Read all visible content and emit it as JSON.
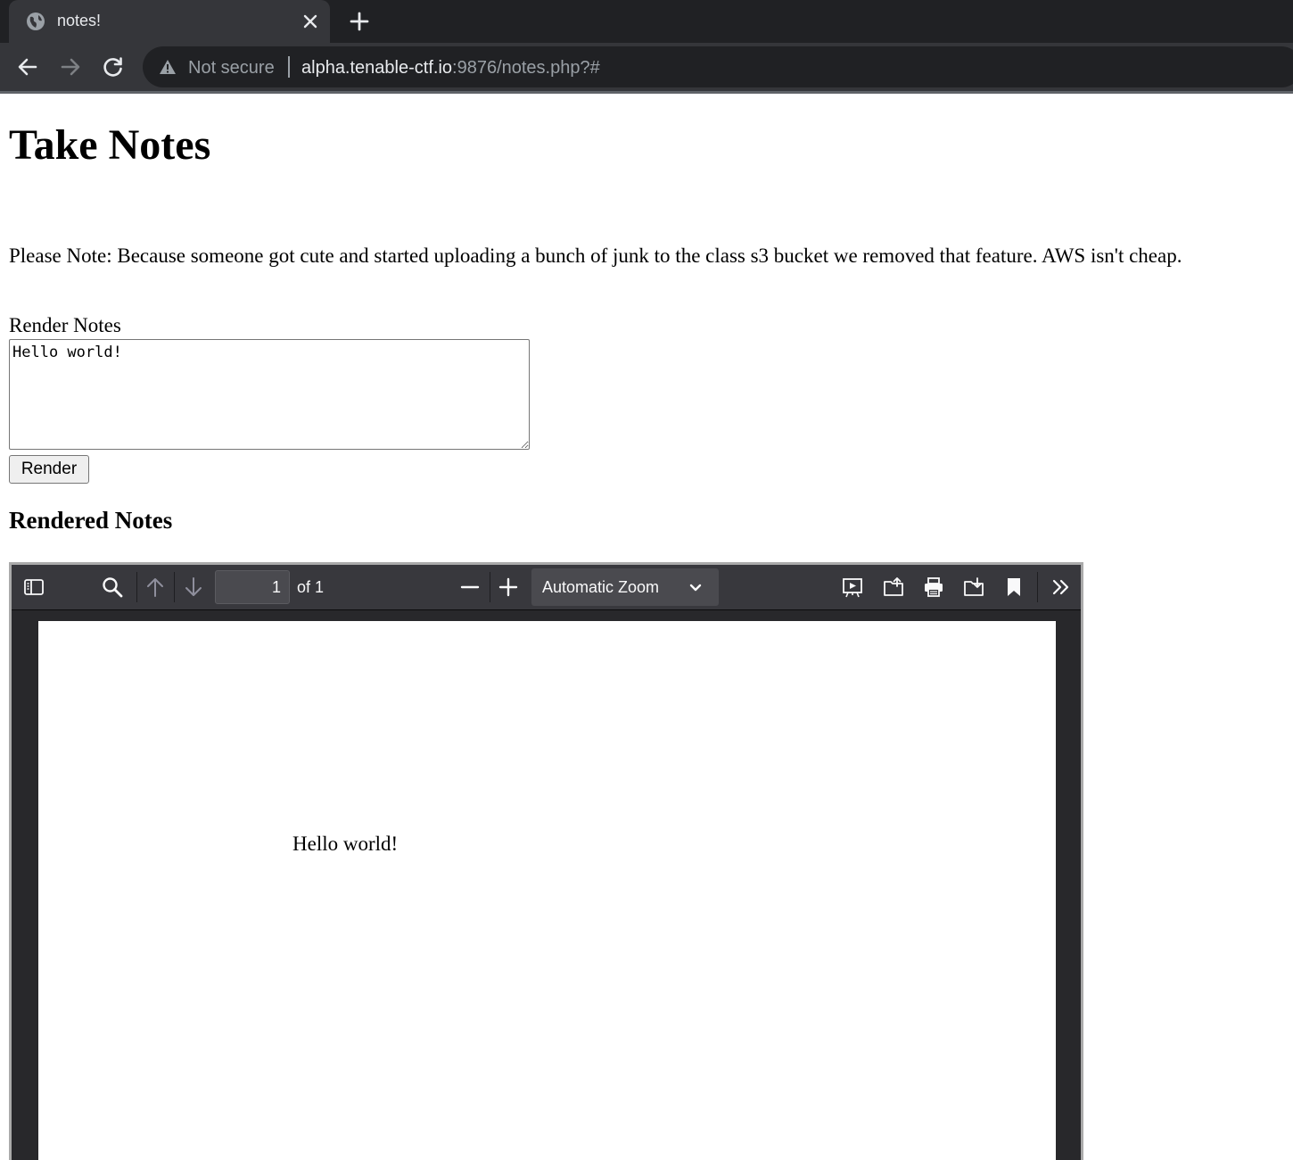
{
  "browser": {
    "tab_title": "notes!",
    "security_label": "Not secure",
    "url_host": "alpha.tenable-ctf.io",
    "url_rest": ":9876/notes.php?#",
    "icons": [
      "globe-icon",
      "close-icon",
      "plus-icon",
      "back-arrow-icon",
      "forward-arrow-icon",
      "reload-icon",
      "warning-icon"
    ]
  },
  "page": {
    "title": "Take Notes",
    "notice": "Please Note: Because someone got cute and started uploading a bunch of junk to the class s3 bucket we removed that feature. AWS isn't cheap.",
    "render_label": "Render Notes",
    "textarea_value": "Hello world!",
    "render_button": "Render",
    "rendered_heading": "Rendered Notes"
  },
  "pdf": {
    "page_number": "1",
    "page_count": "of 1",
    "zoom": "Automatic Zoom",
    "content": "Hello world!",
    "colors": {
      "toolbar": "#38383d",
      "background": "#28282b",
      "field": "#4a4a4f"
    }
  }
}
